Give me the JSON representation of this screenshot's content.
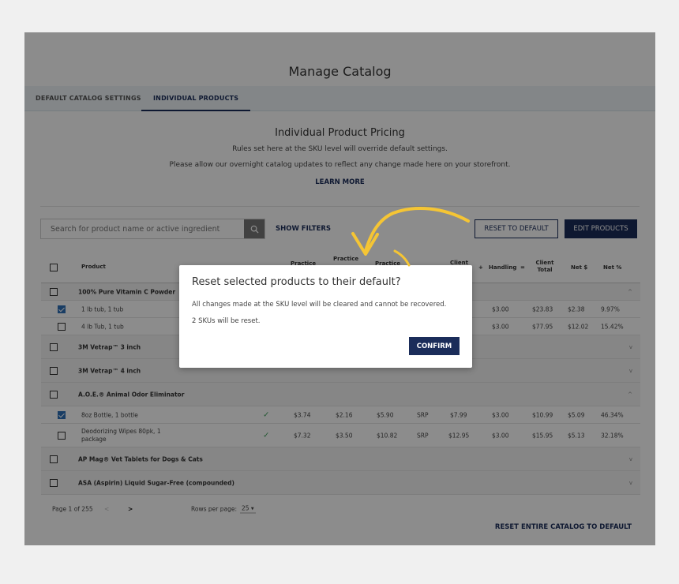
{
  "page": {
    "title": "Manage Catalog",
    "tabs": [
      {
        "label": "DEFAULT CATALOG SETTINGS",
        "active": false
      },
      {
        "label": "INDIVIDUAL PRODUCTS",
        "active": true
      }
    ],
    "section_title": "Individual Product Pricing",
    "description_1": "Rules set here at the SKU level will override default settings.",
    "description_2": "Please allow our overnight catalog updates to reflect any change made here on your storefront.",
    "learn_more": "LEARN MORE"
  },
  "toolbar": {
    "search_placeholder": "Search for product name or active ingredient",
    "show_filters": "SHOW FILTERS",
    "reset_to_default": "RESET TO DEFAULT",
    "edit_products": "EDIT PRODUCTS"
  },
  "table": {
    "headers": {
      "product": "Product",
      "practice_1": "Practice",
      "practice_2": "Practice",
      "practice_3": "Practice",
      "client": "Client",
      "plus": "+",
      "handling": "Handling",
      "equals": "=",
      "client_total": "Client Total",
      "net_dollar": "Net $",
      "net_pct": "Net %"
    },
    "rows": [
      {
        "type": "group",
        "name": "100% Pure Vitamin C Powder",
        "checked": false,
        "expanded": true
      },
      {
        "type": "sku",
        "name": "1 lb tub, 1 tub",
        "checked": true,
        "handling": "$3.00",
        "client_total": "$23.83",
        "net_dollar": "$2.38",
        "net_pct": "9.97%"
      },
      {
        "type": "sku",
        "name": "4 lb Tub, 1 tub",
        "checked": false,
        "handling": "$3.00",
        "client_total": "$77.95",
        "net_dollar": "$12.02",
        "net_pct": "15.42%"
      },
      {
        "type": "group",
        "name": "3M Vetrap™ 3 inch",
        "checked": false,
        "expanded": false
      },
      {
        "type": "group",
        "name": "3M Vetrap™ 4 inch",
        "checked": false,
        "expanded": false
      },
      {
        "type": "group",
        "name": "A.O.E.® Animal Odor Eliminator",
        "checked": false,
        "expanded": true
      },
      {
        "type": "sku",
        "name": "8oz Bottle, 1 bottle",
        "checked": true,
        "p1": "$3.74",
        "p2": "$2.16",
        "p3": "$5.90",
        "mode": "SRP",
        "client": "$7.99",
        "handling": "$3.00",
        "client_total": "$10.99",
        "net_dollar": "$5.09",
        "net_pct": "46.34%"
      },
      {
        "type": "sku",
        "name": "Deodorizing Wipes 80pk, 1 package",
        "checked": false,
        "p1": "$7.32",
        "p2": "$3.50",
        "p3": "$10.82",
        "mode": "SRP",
        "client": "$12.95",
        "handling": "$3.00",
        "client_total": "$15.95",
        "net_dollar": "$5.13",
        "net_pct": "32.18%"
      },
      {
        "type": "group",
        "name": "AP Mag® Vet Tablets for Dogs & Cats",
        "checked": false,
        "expanded": false
      },
      {
        "type": "group",
        "name": "ASA (Aspirin) Liquid Sugar-Free (compounded)",
        "checked": false,
        "expanded": false
      }
    ]
  },
  "pagination": {
    "page_label": "Page 1 of 255",
    "rows_label": "Rows per page:",
    "rows_value": "25"
  },
  "footer": {
    "reset_entire": "RESET ENTIRE CATALOG TO DEFAULT"
  },
  "dialog": {
    "title": "Reset selected products to their default?",
    "message_1": "All changes made at the SKU level will be cleared and cannot be recovered.",
    "message_2": "2 SKUs will be reset.",
    "confirm": "CONFIRM"
  },
  "colors": {
    "brand": "#1b2d5a",
    "checkbox_checked": "#2e6fb7",
    "arrow": "#f5c534",
    "check_green": "#4aa564"
  }
}
